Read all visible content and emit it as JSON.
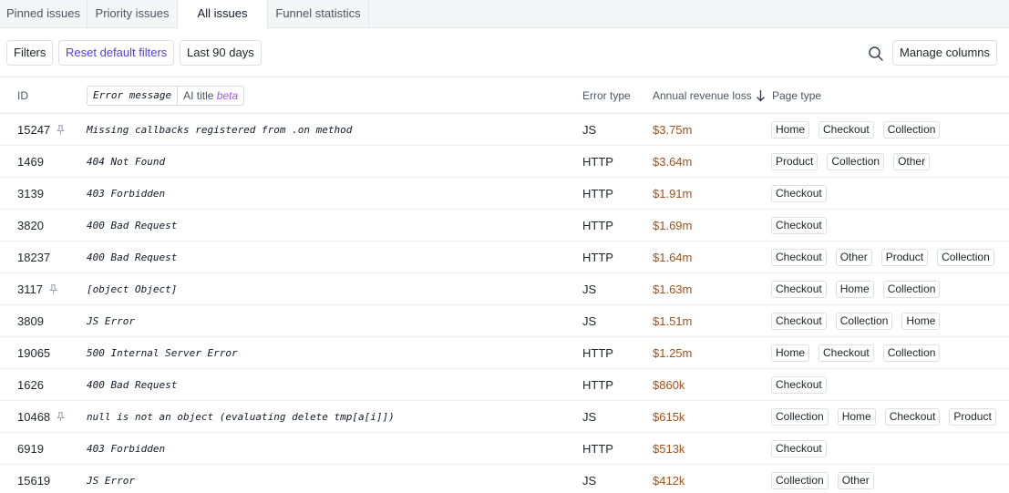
{
  "tabs": [
    {
      "label": "Pinned issues",
      "active": false
    },
    {
      "label": "Priority issues",
      "active": false
    },
    {
      "label": "All issues",
      "active": true
    },
    {
      "label": "Funnel statistics",
      "active": false
    }
  ],
  "toolbar": {
    "filters_label": "Filters",
    "reset_label": "Reset default filters",
    "range_label": "Last 90 days",
    "search_icon": "search-icon",
    "manage_label": "Manage columns"
  },
  "colors": {
    "accent": "#4f3fe0",
    "revenue": "#a0521c",
    "beta": "#a855f7"
  },
  "table": {
    "headers": {
      "id": "ID",
      "error_message": "Error message",
      "ai_title": "AI title",
      "beta": "beta",
      "error_type": "Error type",
      "revenue": "Annual revenue loss",
      "page_type": "Page type"
    },
    "sort_icon": "arrow-down-icon",
    "rows": [
      {
        "id": "15247",
        "pinned": true,
        "message": "Missing callbacks registered from .on method",
        "type": "JS",
        "revenue": "$3.75m",
        "pages": [
          "Home",
          "Checkout",
          "Collection"
        ]
      },
      {
        "id": "1469",
        "pinned": false,
        "message": "404 Not Found",
        "type": "HTTP",
        "revenue": "$3.64m",
        "pages": [
          "Product",
          "Collection",
          "Other"
        ]
      },
      {
        "id": "3139",
        "pinned": false,
        "message": "403 Forbidden",
        "type": "HTTP",
        "revenue": "$1.91m",
        "pages": [
          "Checkout"
        ]
      },
      {
        "id": "3820",
        "pinned": false,
        "message": "400 Bad Request",
        "type": "HTTP",
        "revenue": "$1.69m",
        "pages": [
          "Checkout"
        ]
      },
      {
        "id": "18237",
        "pinned": false,
        "message": "400 Bad Request",
        "type": "HTTP",
        "revenue": "$1.64m",
        "pages": [
          "Checkout",
          "Other",
          "Product",
          "Collection"
        ]
      },
      {
        "id": "3117",
        "pinned": true,
        "message": "[object Object]",
        "type": "JS",
        "revenue": "$1.63m",
        "pages": [
          "Checkout",
          "Home",
          "Collection"
        ]
      },
      {
        "id": "3809",
        "pinned": false,
        "message": "JS Error",
        "type": "JS",
        "revenue": "$1.51m",
        "pages": [
          "Checkout",
          "Collection",
          "Home"
        ]
      },
      {
        "id": "19065",
        "pinned": false,
        "message": "500 Internal Server Error",
        "type": "HTTP",
        "revenue": "$1.25m",
        "pages": [
          "Home",
          "Checkout",
          "Collection"
        ]
      },
      {
        "id": "1626",
        "pinned": false,
        "message": "400 Bad Request",
        "type": "HTTP",
        "revenue": "$860k",
        "pages": [
          "Checkout"
        ]
      },
      {
        "id": "10468",
        "pinned": true,
        "message": "null is not an object (evaluating delete tmp[a[i]])",
        "type": "JS",
        "revenue": "$615k",
        "pages": [
          "Collection",
          "Home",
          "Checkout",
          "Product"
        ]
      },
      {
        "id": "6919",
        "pinned": false,
        "message": "403 Forbidden",
        "type": "HTTP",
        "revenue": "$513k",
        "pages": [
          "Checkout"
        ]
      },
      {
        "id": "15619",
        "pinned": false,
        "message": "JS Error",
        "type": "JS",
        "revenue": "$412k",
        "pages": [
          "Collection",
          "Other"
        ]
      }
    ]
  }
}
